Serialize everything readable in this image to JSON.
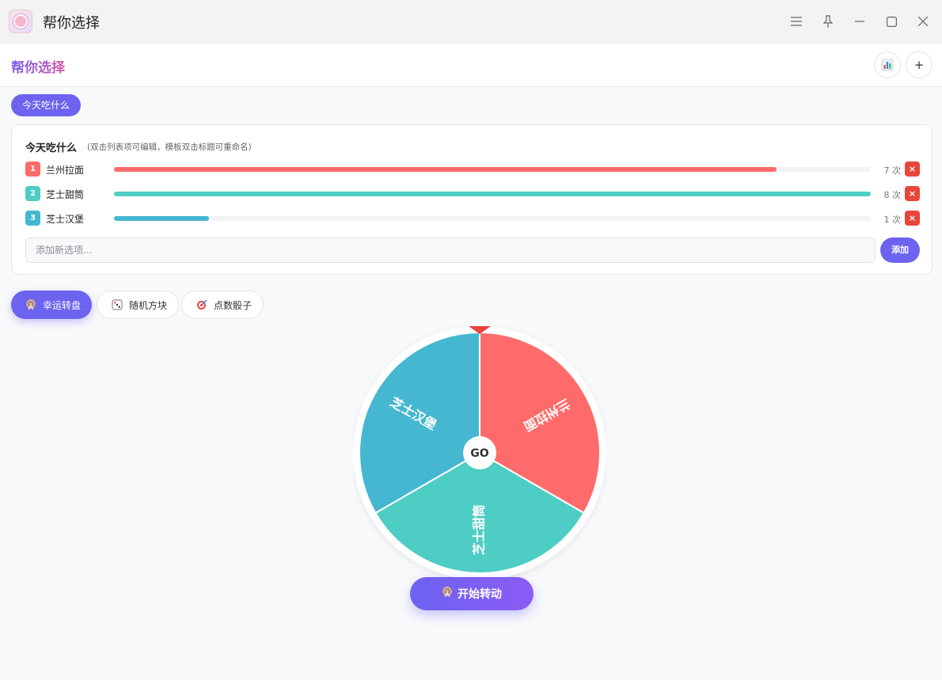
{
  "window": {
    "title": "帮你选择"
  },
  "header": {
    "brand": "帮你选择",
    "stats_icon": "bar-chart-icon",
    "add_label": "+"
  },
  "templates": [
    {
      "label": "今天吃什么",
      "active": true
    }
  ],
  "list_card": {
    "title": "今天吃什么",
    "hint": "(双击列表项可编辑，模板双击标题可重命名)",
    "items": [
      {
        "index": "1",
        "name": "兰州拉面",
        "count_text": "7 次",
        "count": 7,
        "color": "#ff6b6b",
        "delete_label": "×"
      },
      {
        "index": "2",
        "name": "芝士甜筒",
        "count_text": "8 次",
        "count": 8,
        "color": "#4ecdc4",
        "delete_label": "×"
      },
      {
        "index": "3",
        "name": "芝士汉堡",
        "count_text": "1 次",
        "count": 1,
        "color": "#45b7d1",
        "delete_label": "×"
      }
    ],
    "add_placeholder": "添加新选项...",
    "add_button": "添加"
  },
  "modes": [
    {
      "label": "幸运转盘",
      "icon": "ferris-wheel-icon",
      "active": true
    },
    {
      "label": "随机方块",
      "icon": "dice-icon",
      "active": false
    },
    {
      "label": "点数骰子",
      "icon": "target-icon",
      "active": false
    }
  ],
  "wheel": {
    "center_label": "GO",
    "pointer_color": "#e8453c",
    "segments": [
      {
        "label": "兰州拉面",
        "color": "#ff6b6b"
      },
      {
        "label": "芝士甜筒",
        "color": "#4ecdc4"
      },
      {
        "label": "芝士汉堡",
        "color": "#45b7d1"
      }
    ]
  },
  "spin_button": {
    "label": "开始转动",
    "icon": "ferris-wheel-icon"
  }
}
